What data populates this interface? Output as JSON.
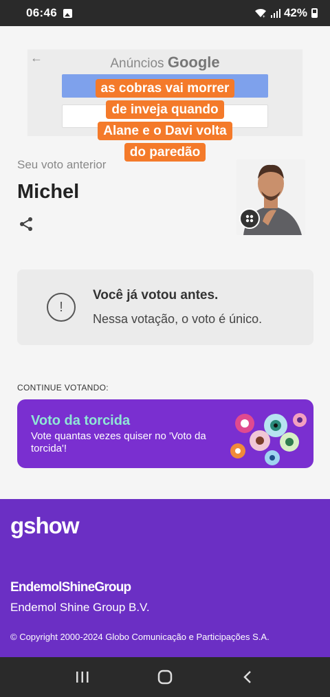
{
  "status_bar": {
    "time": "06:46",
    "battery": "42%"
  },
  "ad": {
    "label_prefix": "Anúncios",
    "label_brand": "Google"
  },
  "caption": {
    "lines": [
      "as cobras vai morrer",
      "de inveja quando",
      "Alane e o Davi volta",
      "do paredão"
    ]
  },
  "vote": {
    "previous_label": "Seu voto anterior",
    "candidate_name": "Michel"
  },
  "notice": {
    "title": "Você já votou antes.",
    "text": "Nessa votação, o voto é único."
  },
  "continue": {
    "label": "CONTINUE VOTANDO:",
    "card_title": "Voto da torcida",
    "card_subtitle": "Vote quantas vezes quiser no 'Voto da torcida'!"
  },
  "footer": {
    "logo": "gshow",
    "partner_logo": "EndemolShineGroup",
    "partner_name": "Endemol Shine Group B.V.",
    "copyright": "© Copyright 2000-2024 Globo Comunicação e Participações S.A."
  },
  "colors": {
    "accent_purple": "#6b2fc4",
    "card_purple": "#7a2fd0",
    "caption_orange": "#f47a2a",
    "torcida_title": "#8fe6d6"
  },
  "icons": [
    "image-icon",
    "wifi-icon",
    "signal-icon",
    "battery-icon",
    "back-arrow-icon",
    "share-icon",
    "grid-icon",
    "alert-icon",
    "recents-icon",
    "home-icon",
    "back-icon"
  ]
}
